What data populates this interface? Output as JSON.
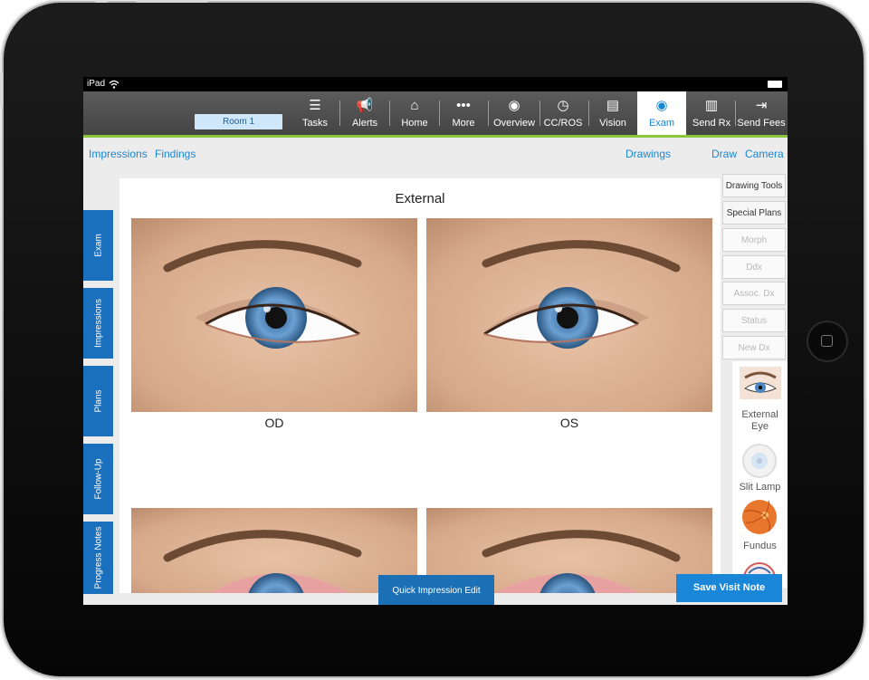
{
  "status_bar": {
    "carrier": "iPad"
  },
  "toolbar": {
    "room_label": "Room 1",
    "items": [
      {
        "label": "Tasks",
        "icon": "tasks-icon"
      },
      {
        "label": "Alerts",
        "icon": "megaphone-icon"
      },
      {
        "label": "Home",
        "icon": "home-icon"
      },
      {
        "label": "More",
        "icon": "more-icon"
      },
      {
        "label": "Overview",
        "icon": "person-icon"
      },
      {
        "label": "CC/ROS",
        "icon": "clock-icon"
      },
      {
        "label": "Vision",
        "icon": "monitor-icon"
      },
      {
        "label": "Exam",
        "icon": "eye-icon"
      },
      {
        "label": "Send Rx",
        "icon": "document-icon"
      },
      {
        "label": "Send Fees",
        "icon": "document-arrow-icon"
      }
    ],
    "active_item": "Exam",
    "accent_color": "#8cc63f"
  },
  "subnav": {
    "impressions": "Impressions",
    "findings": "Findings",
    "drawings": "Drawings",
    "draw": "Draw",
    "camera": "Camera"
  },
  "side_tabs": [
    "Exam",
    "Impressions",
    "Plans",
    "Follow-Up",
    "Progress Notes"
  ],
  "main": {
    "title": "External",
    "left_caption": "OD",
    "right_caption": "OS"
  },
  "right_panel": {
    "buttons": [
      {
        "label": "Drawing Tools",
        "enabled": true
      },
      {
        "label": "Special Plans",
        "enabled": true
      },
      {
        "label": "Morph",
        "enabled": false
      },
      {
        "label": "Ddx",
        "enabled": false
      },
      {
        "label": "Assoc. Dx",
        "enabled": false
      },
      {
        "label": "Status",
        "enabled": false
      },
      {
        "label": "New Dx",
        "enabled": false
      }
    ],
    "thumbnails": [
      {
        "label": "External Eye"
      },
      {
        "label": "Slit Lamp"
      },
      {
        "label": "Fundus"
      }
    ]
  },
  "actions": {
    "quick_impression": "Quick Impression Edit",
    "save_visit": "Save Visit Note"
  },
  "colors": {
    "primary_blue": "#1a86d0",
    "tab_blue": "#1a70bd"
  }
}
